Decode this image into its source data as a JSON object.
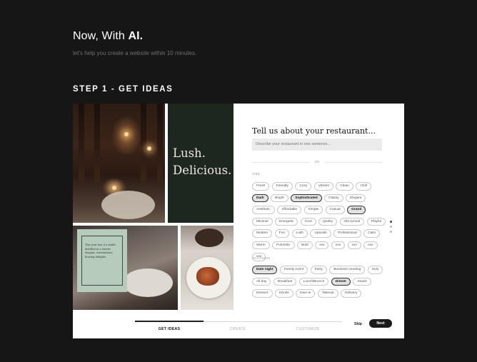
{
  "hero": {
    "title_prefix": "Now, With ",
    "title_bold": "AI.",
    "subtitle": "let's help you create a website within 10 minutes."
  },
  "step": {
    "title": "STEP 1 - GET IDEAS"
  },
  "collage": {
    "tagline_line1": "Lush.",
    "tagline_line2": "Delicious.",
    "card_text": "This year has it a sinful, distilled at a slower elegant, ostentatious, flowing delights."
  },
  "form": {
    "title": "Tell us about your restaurant...",
    "input_placeholder": "Describe your restaurant in one sentence...",
    "or": "OR",
    "vibe_label": "VIBE",
    "vibe_chips": [
      {
        "label": "Fresh",
        "selected": false
      },
      {
        "label": "Friendly",
        "selected": false
      },
      {
        "label": "Cozy",
        "selected": false
      },
      {
        "label": "Vibrant",
        "selected": false
      },
      {
        "label": "Clean",
        "selected": false
      },
      {
        "label": "Chill",
        "selected": false
      },
      {
        "label": "Dark",
        "selected": true
      },
      {
        "label": "Bright",
        "selected": false
      },
      {
        "label": "Sophisticated",
        "selected": true
      },
      {
        "label": "Classy",
        "selected": false
      },
      {
        "label": "Elegant",
        "selected": false
      },
      {
        "label": "Aesthetic",
        "selected": false
      },
      {
        "label": "Affordable",
        "selected": false
      },
      {
        "label": "Simple",
        "selected": false
      },
      {
        "label": "Casual",
        "selected": false
      },
      {
        "label": "Grand",
        "selected": true
      },
      {
        "label": "Minimal",
        "selected": false
      },
      {
        "label": "Energetic",
        "selected": false
      },
      {
        "label": "Cool",
        "selected": false
      },
      {
        "label": "Quirky",
        "selected": false
      },
      {
        "label": "Old school",
        "selected": false
      },
      {
        "label": "Playful",
        "selected": false
      },
      {
        "label": "Modern",
        "selected": false
      },
      {
        "label": "Fun",
        "selected": false
      },
      {
        "label": "Lush",
        "selected": false
      },
      {
        "label": "Upscale",
        "selected": false
      },
      {
        "label": "Professional",
        "selected": false
      },
      {
        "label": "Calm",
        "selected": false
      },
      {
        "label": "Warm",
        "selected": false
      },
      {
        "label": "Futuristic",
        "selected": false
      },
      {
        "label": "Bold",
        "selected": false
      },
      {
        "label": "xxx",
        "selected": false
      },
      {
        "label": "xxx",
        "selected": false
      },
      {
        "label": "xxx",
        "selected": false
      },
      {
        "label": "xxx",
        "selected": false
      },
      {
        "label": "xxx",
        "selected": false
      }
    ],
    "occasion_label": "OCCASION",
    "occasion_chips": [
      {
        "label": "Date night",
        "selected": true
      },
      {
        "label": "Family event",
        "selected": false
      },
      {
        "label": "Party",
        "selected": false
      },
      {
        "label": "Business meeting",
        "selected": false
      },
      {
        "label": "Solo",
        "selected": false
      },
      {
        "label": "All day",
        "selected": false
      },
      {
        "label": "Breakfast",
        "selected": false
      },
      {
        "label": "Lunch/Brunch",
        "selected": false
      },
      {
        "label": "Dinner",
        "selected": true
      },
      {
        "label": "Snack",
        "selected": false
      },
      {
        "label": "Dessert",
        "selected": false
      },
      {
        "label": "Drinks",
        "selected": false
      },
      {
        "label": "Dine-in",
        "selected": false
      },
      {
        "label": "Takeout",
        "selected": false
      },
      {
        "label": "Delivery",
        "selected": false
      }
    ]
  },
  "wizard": {
    "steps": [
      "GET IDEAS",
      "CREATE",
      "CUSTOMIZE"
    ],
    "active_step": 0,
    "skip": "Skip",
    "next": "Next"
  }
}
